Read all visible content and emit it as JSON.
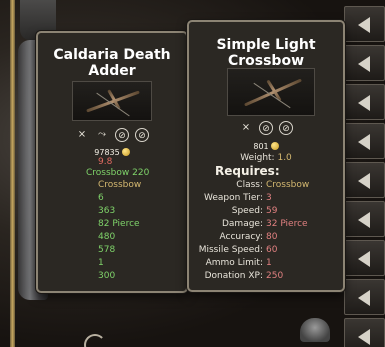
{
  "left_tooltip": {
    "title": "Caldaria Death Adder",
    "image": "crossbow-image",
    "flags": [
      "crossbow-flag-icon",
      "bow-flag-icon",
      "cant-use-on-horseback-icon",
      "cant-reload-icon"
    ],
    "price": "97835",
    "stats": [
      {
        "value": "9.8",
        "color": "red"
      },
      {
        "value": "Crossbow 220",
        "color": "green"
      },
      {
        "value": "Crossbow",
        "color": "gold"
      },
      {
        "value": "6",
        "color": "green"
      },
      {
        "value": "363",
        "color": "green"
      },
      {
        "value": "82 Pierce",
        "color": "green"
      },
      {
        "value": "480",
        "color": "green"
      },
      {
        "value": "578",
        "color": "green"
      },
      {
        "value": "1",
        "color": "green"
      },
      {
        "value": "300",
        "color": "green"
      }
    ]
  },
  "right_tooltip": {
    "title": "Simple Light Crossbow",
    "image": "crossbow-image",
    "flags": [
      "crossbow-flag-icon",
      "cant-use-on-horseback-icon",
      "cant-reload-icon"
    ],
    "price": "801",
    "weight_label": "Weight:",
    "weight_value": "1.0",
    "requires_label": "Requires:",
    "requirements": [
      {
        "label": "Class:",
        "value": "Crossbow",
        "color": "gold"
      },
      {
        "label": "Weapon Tier:",
        "value": "3",
        "color": "pink"
      },
      {
        "label": "Speed:",
        "value": "59",
        "color": "pink"
      },
      {
        "label": "Damage:",
        "value": "32 Pierce",
        "color": "pink"
      },
      {
        "label": "Accuracy:",
        "value": "80",
        "color": "pink"
      },
      {
        "label": "Missile Speed:",
        "value": "60",
        "color": "pink"
      },
      {
        "label": "Ammo Limit:",
        "value": "1",
        "color": "pink"
      },
      {
        "label": "Donation XP:",
        "value": "250",
        "color": "pink"
      }
    ]
  },
  "colors": {
    "red": "#e06a60",
    "green": "#7fd36a",
    "gold": "#d4b870",
    "pink": "#e08080",
    "panel_bg": "#2b2823",
    "panel_border": "#8c8474"
  },
  "side_slots": [
    "chevron-left-icon",
    "chevron-left-icon",
    "chevron-left-icon",
    "chevron-left-icon",
    "chevron-left-icon",
    "chevron-left-icon",
    "chevron-left-icon",
    "chevron-left-icon",
    "chevron-left-icon",
    "chevron-left-icon"
  ]
}
